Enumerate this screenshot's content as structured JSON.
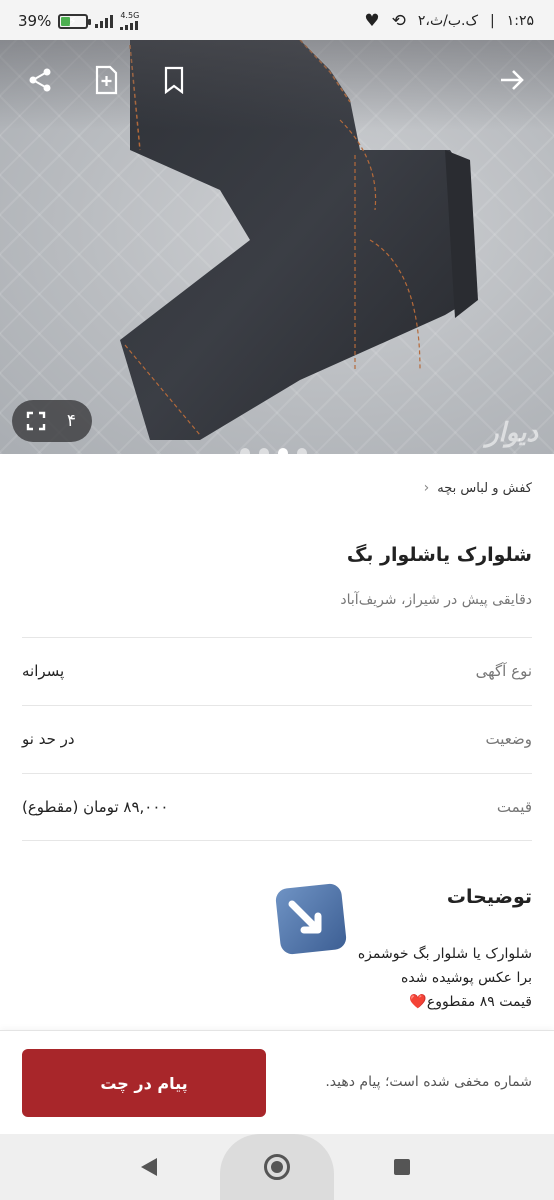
{
  "status_bar": {
    "time": "۱:۲۵",
    "date": "۲،ک.ب/ث",
    "separator": "|",
    "battery_percent": "39%",
    "battery_level": 0.39,
    "network_type": "4.5G"
  },
  "hero": {
    "photo_counter": "۴",
    "dot_count": 4,
    "active_dot": 2,
    "watermark": "دیوار",
    "icons": [
      "share-icon",
      "add-note-icon",
      "bookmark-icon",
      "back-arrow-icon",
      "fullscreen-icon"
    ]
  },
  "breadcrumb": {
    "category": "کفش و لباس بچه"
  },
  "listing": {
    "title": "شلوارک یاشلوار بگ",
    "subtitle": "دقایقی پیش در شیراز، شریف‌آباد"
  },
  "attributes": [
    {
      "label": "نوع آگهی",
      "value": "پسرانه"
    },
    {
      "label": "وضعیت",
      "value": "در حد نو"
    },
    {
      "label": "قیمت",
      "value": "۸۹,۰۰۰ تومان (مقطوع)"
    }
  ],
  "description": {
    "heading": "توضیحات",
    "lines": [
      "شلوارک یا شلوار بگ خوشمزه",
      "برا عکس پوشیده شده",
      "قیمت ۸۹ مقطووع"
    ],
    "heart": "❤️"
  },
  "action_bar": {
    "chat_button": "پیام در چت",
    "phone_note": "شماره مخفی شده است؛ پیام دهید."
  },
  "colors": {
    "primary": "#a8262a",
    "heart": "#e0323c",
    "muted_text": "#777777"
  }
}
